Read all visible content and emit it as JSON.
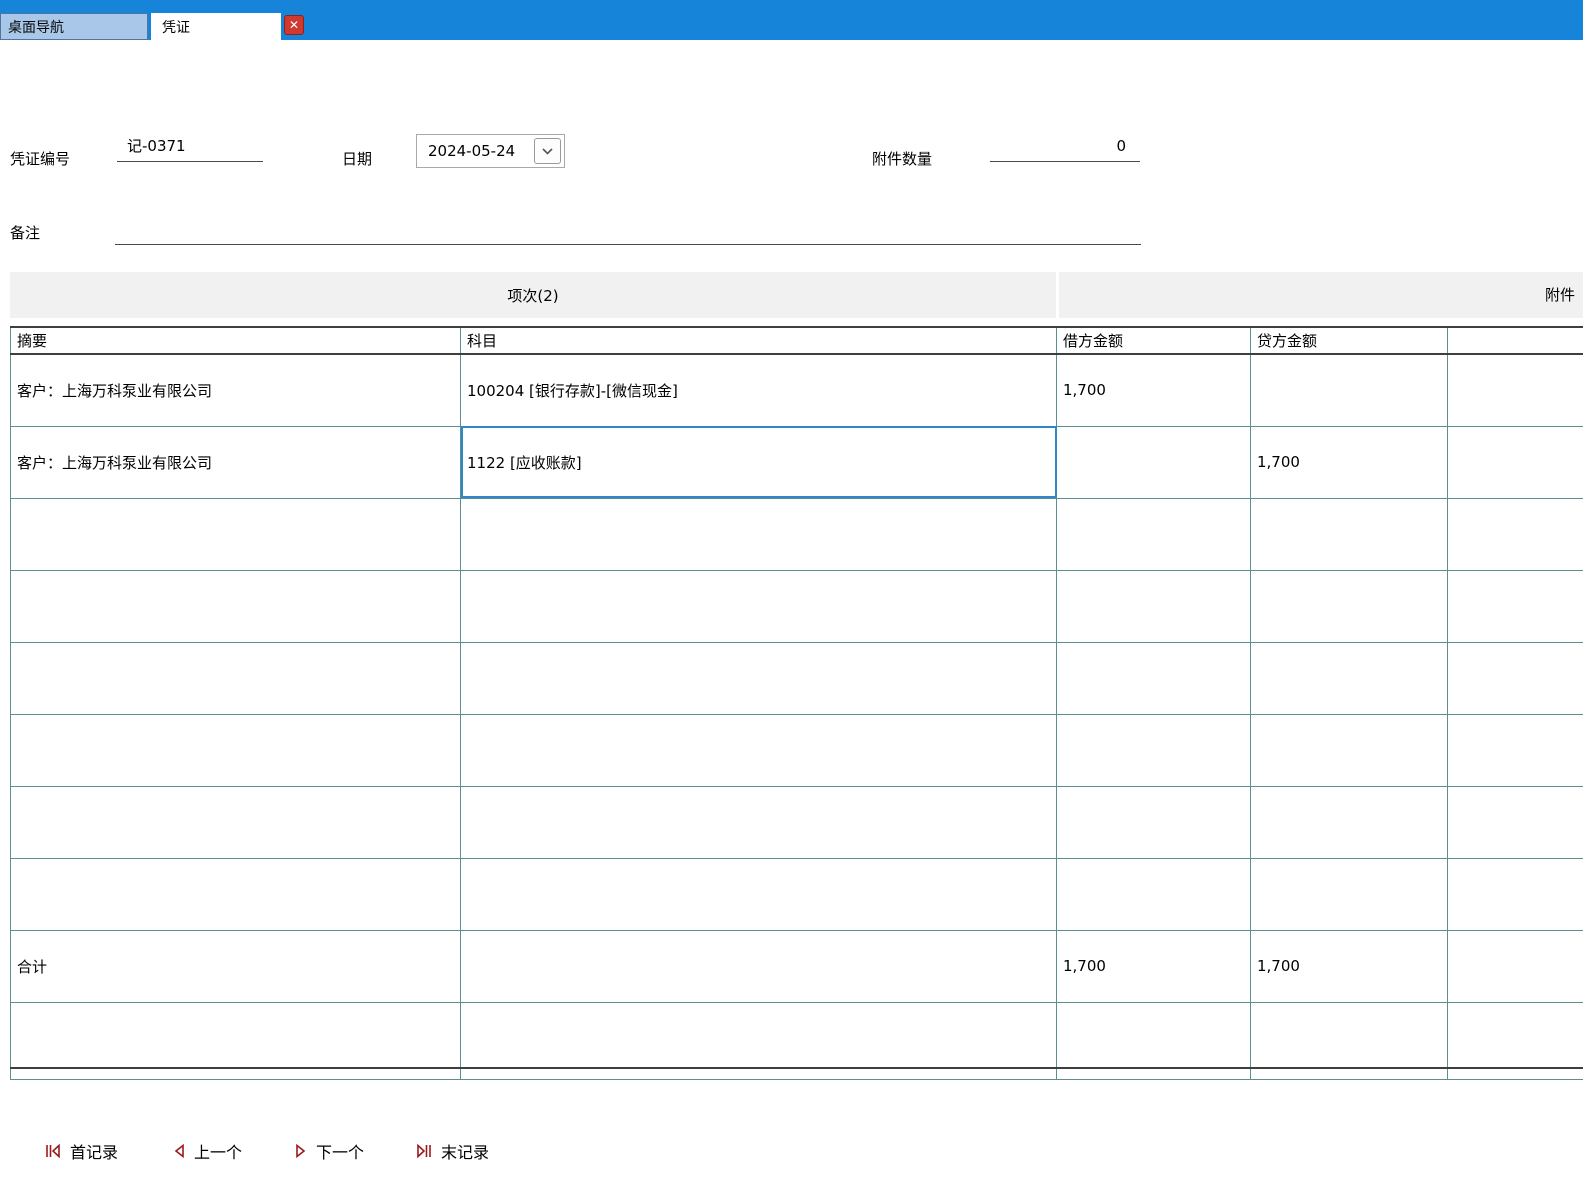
{
  "titlebar": {
    "tab_desktop_nav": "桌面导航",
    "tab_voucher": "凭证",
    "close_glyph": "✕"
  },
  "form": {
    "voucher_no_label": "凭证编号",
    "voucher_no_value": "记-0371",
    "date_label": "日期",
    "date_value": "2024-05-24",
    "attachment_count_label": "附件数量",
    "attachment_count_value": "0",
    "remark_label": "备注",
    "remark_value": ""
  },
  "section_tabs": {
    "items": "项次(2)",
    "attachment": "附件"
  },
  "table": {
    "headers": {
      "summary": "摘要",
      "account": "科目",
      "debit": "借方金额",
      "credit": "贷方金额",
      "extra": ""
    },
    "rows": [
      {
        "summary": "客户：上海万科泵业有限公司",
        "account": "100204 [银行存款]-[微信现金]",
        "debit": "1,700",
        "credit": ""
      },
      {
        "summary": "客户：上海万科泵业有限公司",
        "account": "1122 [应收账款]",
        "debit": "",
        "credit": "1,700"
      }
    ],
    "total": {
      "label": "合计",
      "debit": "1,700",
      "credit": "1,700"
    }
  },
  "record_nav": {
    "first": "首记录",
    "prev": "上一个",
    "next": "下一个",
    "last": "末记录"
  },
  "colors": {
    "titlebar_blue": "#1584d9",
    "selected_tab_blue": "#a9c7e8",
    "table_border_teal": "#5d8f8f",
    "selected_cell_blue": "#2f86c8",
    "nav_icon_red": "#9b1b1b",
    "close_red": "#cf3a30"
  }
}
